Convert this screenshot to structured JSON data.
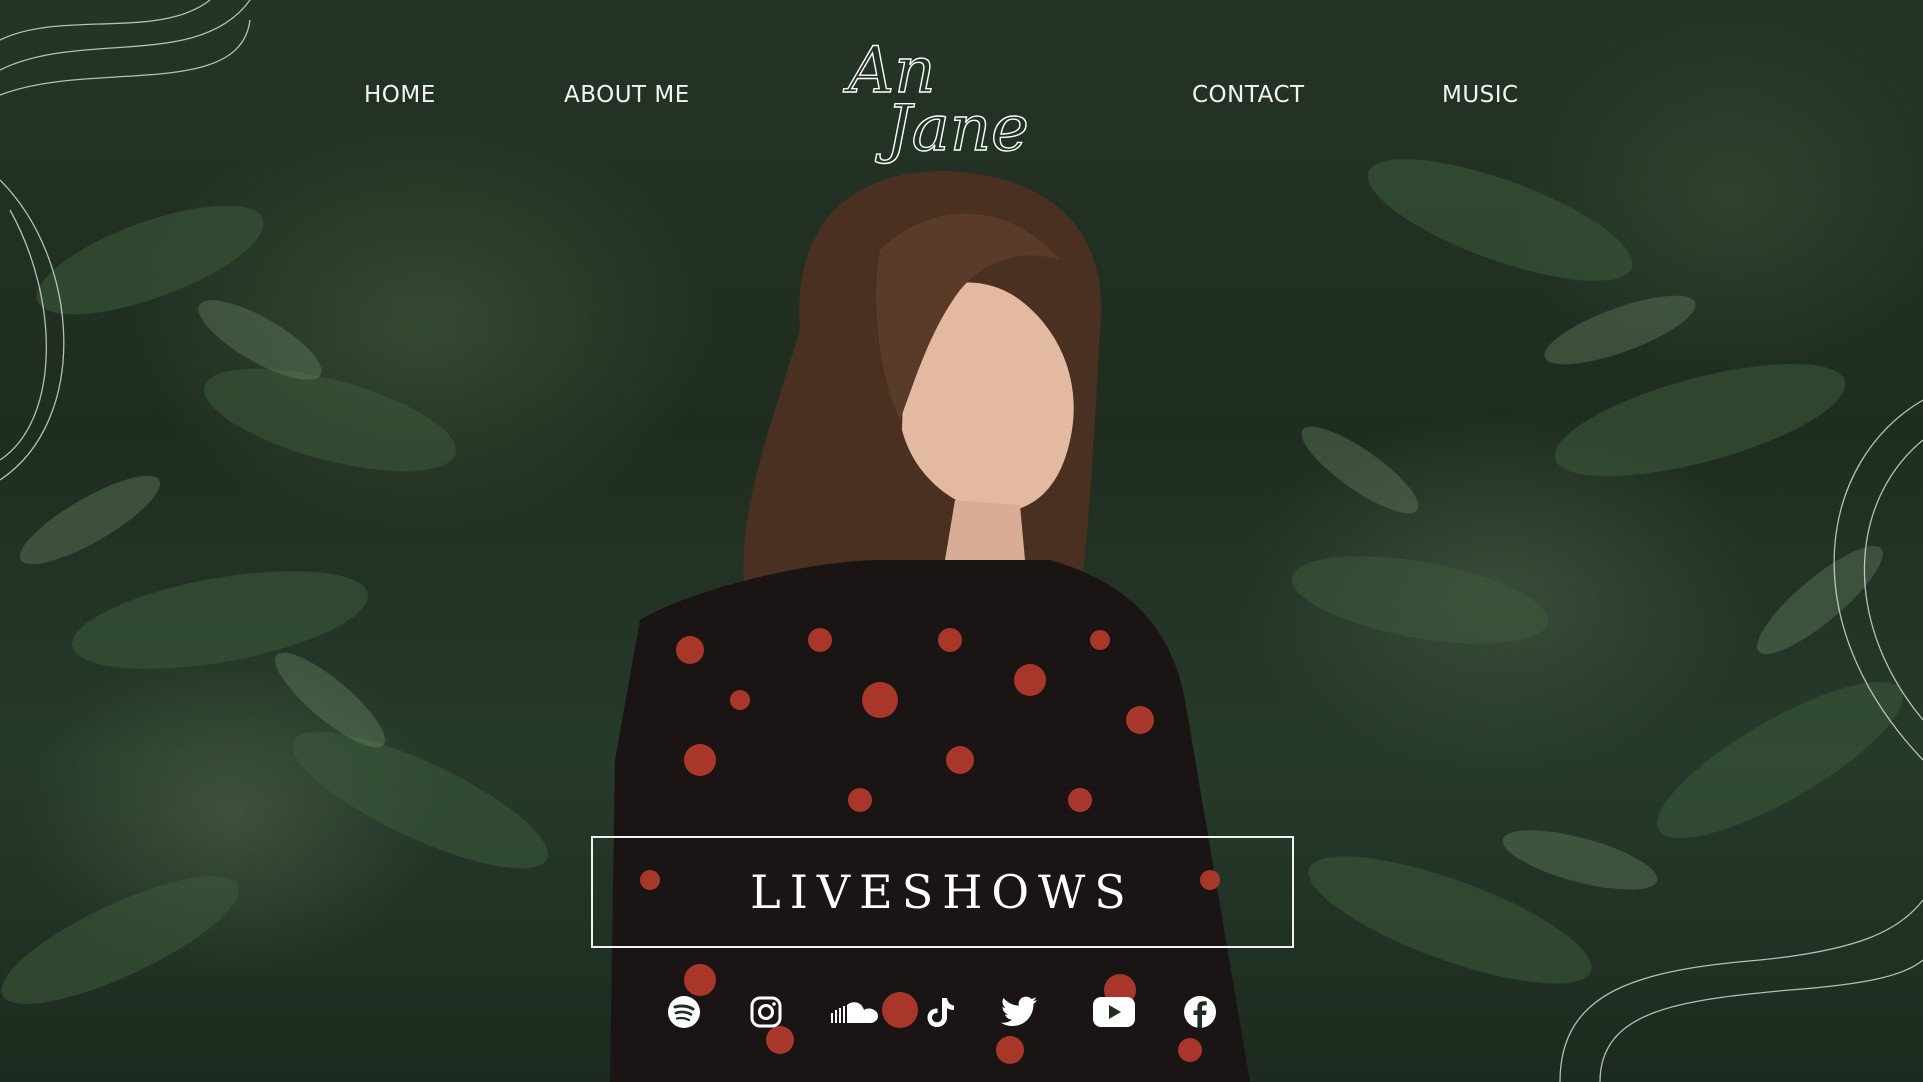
{
  "nav": {
    "home": "HOME",
    "about": "ABOUT ME",
    "contact": "CONTACT",
    "music": "MUSIC"
  },
  "logo": {
    "line1": "An",
    "line2": "Jane"
  },
  "hero": {
    "button_label": "LIVESHOWS"
  },
  "socials": [
    {
      "icon": "spotify-icon"
    },
    {
      "icon": "instagram-icon"
    },
    {
      "icon": "soundcloud-icon"
    },
    {
      "icon": "tiktok-icon"
    },
    {
      "icon": "twitter-icon"
    },
    {
      "icon": "youtube-icon"
    },
    {
      "icon": "facebook-icon"
    }
  ],
  "colors": {
    "text": "#ffffff",
    "foliage_dark": "#1f2d21",
    "dress_red": "#b83a2c",
    "hair": "#5a3a28"
  }
}
